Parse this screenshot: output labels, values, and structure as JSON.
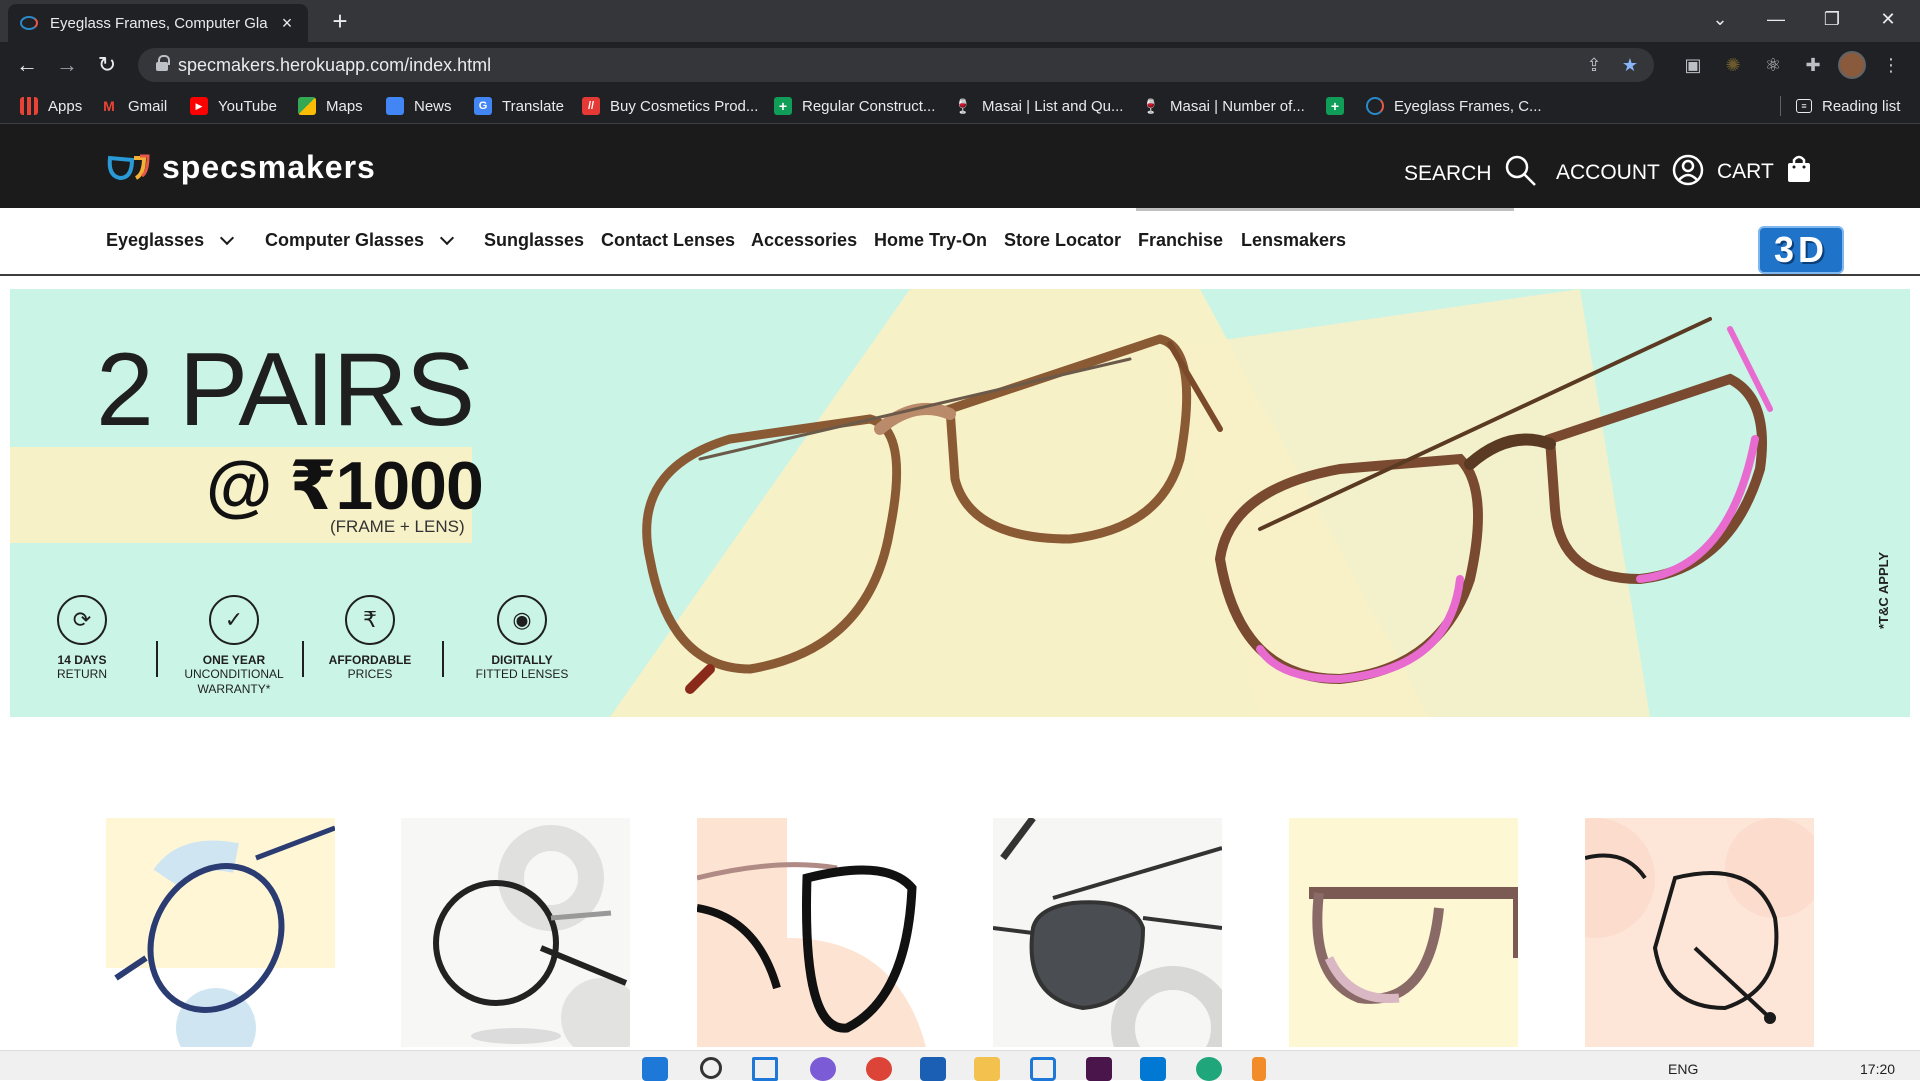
{
  "browser": {
    "tab_title": "Eyeglass Frames, Computer Glass",
    "tab_close": "×",
    "new_tab": "+",
    "url": "specmakers.herokuapp.com/index.html",
    "window_controls": {
      "dropdown": "⌄",
      "minimize": "—",
      "restore": "❐",
      "close": "✕"
    },
    "bookmarks": [
      {
        "label": "Apps",
        "icon": "apps-grid-icon"
      },
      {
        "label": "Gmail",
        "icon": "gmail-icon"
      },
      {
        "label": "YouTube",
        "icon": "youtube-icon"
      },
      {
        "label": "Maps",
        "icon": "maps-icon"
      },
      {
        "label": "News",
        "icon": "news-icon"
      },
      {
        "label": "Translate",
        "icon": "translate-icon"
      },
      {
        "label": "Buy Cosmetics Prod...",
        "icon": "cosmetics-icon"
      },
      {
        "label": "Regular Construct...",
        "icon": "construct-icon"
      },
      {
        "label": "Masai | List and Qu...",
        "icon": "masai-icon"
      },
      {
        "label": "Masai | Number of...",
        "icon": "masai-icon"
      },
      {
        "label": "",
        "icon": "construct-icon"
      },
      {
        "label": "Eyeglass Frames, C...",
        "icon": "specsmakers-icon"
      }
    ],
    "reading_list": "Reading list"
  },
  "site": {
    "logo_text": "specsmakers",
    "header_links": {
      "search": "SEARCH",
      "account": "ACCOUNT",
      "cart": "CART"
    },
    "nav": [
      {
        "label": "Eyeglasses",
        "dropdown": true
      },
      {
        "label": "Computer Glasses",
        "dropdown": true
      },
      {
        "label": "Sunglasses",
        "dropdown": false
      },
      {
        "label": "Contact Lenses",
        "dropdown": false
      },
      {
        "label": "Accessories",
        "dropdown": false
      },
      {
        "label": "Home Try-On",
        "dropdown": false
      },
      {
        "label": "Store Locator",
        "dropdown": false
      },
      {
        "label": "Franchise",
        "dropdown": false
      },
      {
        "label": "Lensmakers",
        "dropdown": false
      }
    ],
    "badge_3d": "3D"
  },
  "banner": {
    "headline": "2 PAIRS",
    "price": "@ ₹1000",
    "price_note": "(FRAME + LENS)",
    "features": [
      {
        "line1": "14 DAYS",
        "line2": "RETURN",
        "icon": "return-arrows-icon"
      },
      {
        "line1": "ONE YEAR",
        "line2": "UNCONDITIONAL WARRANTY*",
        "icon": "warranty-check-icon"
      },
      {
        "line1": "AFFORDABLE",
        "line2": "PRICES",
        "icon": "rupee-hand-icon"
      },
      {
        "line1": "DIGITALLY",
        "line2": "FITTED LENSES",
        "icon": "eye-lens-icon"
      }
    ],
    "tnc": "*T&C APPLY"
  },
  "products": [
    {
      "name": "blue-metal-frame",
      "bg": "#fff6d6"
    },
    {
      "name": "black-round-frame",
      "bg": "#f7f7f5"
    },
    {
      "name": "cat-eye-frame",
      "bg": "#fde3d2"
    },
    {
      "name": "aviator-sunglasses",
      "bg": "#f6f6f4"
    },
    {
      "name": "tortoise-square-frame",
      "bg": "#fdf7d3"
    },
    {
      "name": "black-wire-frame",
      "bg": "#fde6d8"
    }
  ],
  "taskbar": {
    "lang": "ENG",
    "time": "17:20"
  }
}
